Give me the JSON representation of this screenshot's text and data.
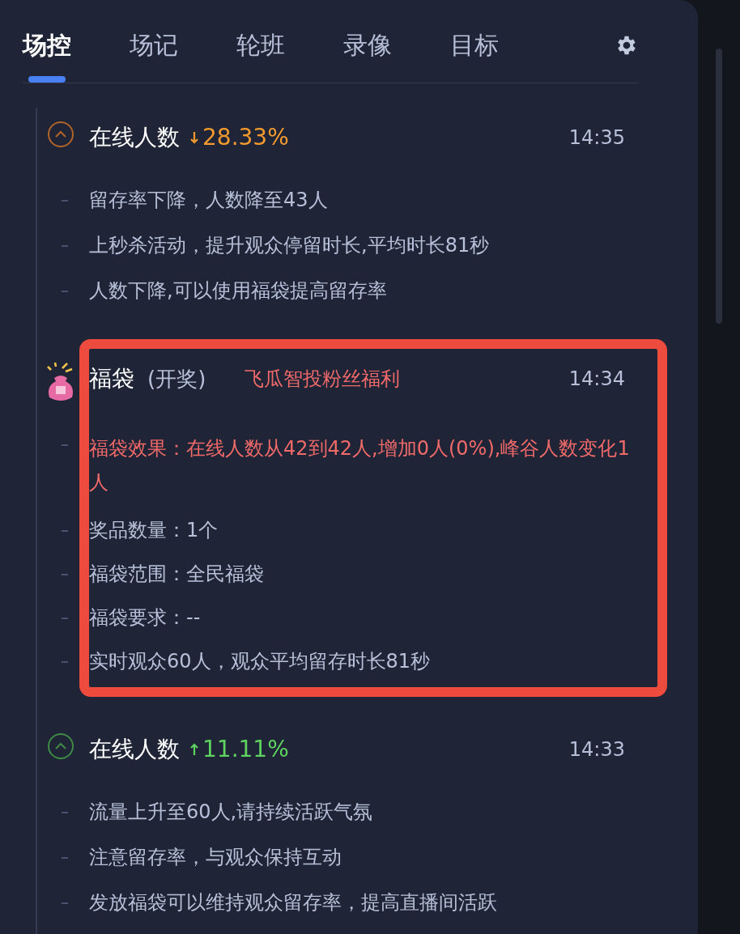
{
  "tabs": [
    {
      "label": "场控",
      "selected": true
    },
    {
      "label": "场记",
      "selected": false
    },
    {
      "label": "轮班",
      "selected": false
    },
    {
      "label": "录像",
      "selected": false
    },
    {
      "label": "目标",
      "selected": false
    }
  ],
  "entries": [
    {
      "kind": "metric",
      "title": "在线人数",
      "rising": false,
      "change": "28.33%",
      "time": "14:35",
      "highlighted": false,
      "lines": [
        {
          "text": "留存率下降，人数降至43人",
          "alert": false
        },
        {
          "text": "上秒杀活动，提升观众停留时长,平均时长81秒",
          "alert": false
        },
        {
          "text": "人数下降,可以使用福袋提高留存率",
          "alert": false
        }
      ]
    },
    {
      "kind": "lucky_bag",
      "title": "福袋",
      "subtitle": "(开奖)",
      "note": "飞瓜智投粉丝福利",
      "time": "14:34",
      "highlighted": true,
      "lines": [
        {
          "text": "福袋效果：在线人数从42到42人,增加0人(0%),峰谷人数变化1人",
          "alert": true
        },
        {
          "text": "奖品数量：1个",
          "alert": false
        },
        {
          "text": "福袋范围：全民福袋",
          "alert": false
        },
        {
          "text": "福袋要求：--",
          "alert": false
        },
        {
          "text": "实时观众60人，观众平均留存时长81秒",
          "alert": false
        }
      ]
    },
    {
      "kind": "metric",
      "title": "在线人数",
      "rising": true,
      "change": "11.11%",
      "time": "14:33",
      "highlighted": false,
      "lines": [
        {
          "text": "流量上升至60人,请持续活跃气氛",
          "alert": false
        },
        {
          "text": "注意留存率，与观众保持互动",
          "alert": false
        },
        {
          "text": "发放福袋可以维持观众留存率，提高直播间活跃",
          "alert": false
        }
      ]
    }
  ]
}
